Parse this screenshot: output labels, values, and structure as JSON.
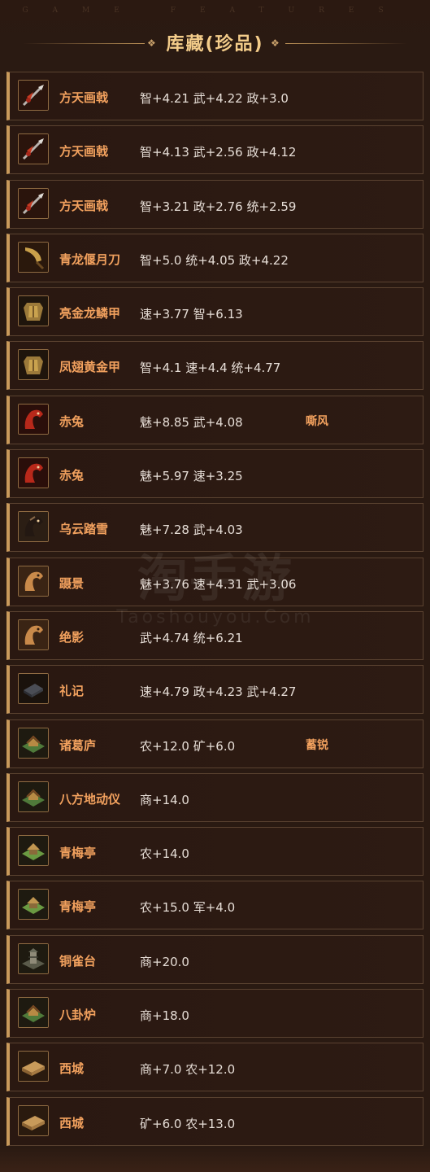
{
  "header": {
    "subtitle": "GAME FEATURES",
    "title": "库藏(珍品)"
  },
  "items": [
    {
      "name": "方天画戟",
      "stats": "智+4.21 武+4.22 政+3.0",
      "skill": "",
      "icon": "halberd-icon"
    },
    {
      "name": "方天画戟",
      "stats": "智+4.13 武+2.56 政+4.12",
      "skill": "",
      "icon": "halberd-icon"
    },
    {
      "name": "方天画戟",
      "stats": "智+3.21 政+2.76 统+2.59",
      "skill": "",
      "icon": "halberd-icon"
    },
    {
      "name": "青龙偃月刀",
      "stats": "智+5.0 统+4.05 政+4.22",
      "skill": "",
      "icon": "glaive-icon"
    },
    {
      "name": "亮金龙鳞甲",
      "stats": "速+3.77 智+6.13",
      "skill": "",
      "icon": "armor-icon"
    },
    {
      "name": "凤翅黄金甲",
      "stats": "智+4.1 速+4.4 统+4.77",
      "skill": "",
      "icon": "armor-icon"
    },
    {
      "name": "赤兔",
      "stats": "魅+8.85 武+4.08",
      "skill": "嘶风",
      "icon": "red-horse-icon"
    },
    {
      "name": "赤兔",
      "stats": "魅+5.97 速+3.25",
      "skill": "",
      "icon": "red-horse-icon"
    },
    {
      "name": "乌云踏雪",
      "stats": "魅+7.28 武+4.03",
      "skill": "",
      "icon": "black-horse-icon"
    },
    {
      "name": "蹑景",
      "stats": "魅+3.76 速+4.31 武+3.06",
      "skill": "",
      "icon": "horse-icon"
    },
    {
      "name": "绝影",
      "stats": "武+4.74 统+6.21",
      "skill": "",
      "icon": "horse-icon"
    },
    {
      "name": "礼记",
      "stats": "速+4.79 政+4.23 武+4.27",
      "skill": "",
      "icon": "book-icon"
    },
    {
      "name": "诸葛庐",
      "stats": "农+12.0 矿+6.0",
      "skill": "蓄锐",
      "icon": "building-icon"
    },
    {
      "name": "八方地动仪",
      "stats": "商+14.0",
      "skill": "",
      "icon": "building-icon"
    },
    {
      "name": "青梅亭",
      "stats": "农+14.0",
      "skill": "",
      "icon": "pavilion-icon"
    },
    {
      "name": "青梅亭",
      "stats": "农+15.0 军+4.0",
      "skill": "",
      "icon": "pavilion-icon"
    },
    {
      "name": "铜雀台",
      "stats": "商+20.0",
      "skill": "",
      "icon": "tower-icon"
    },
    {
      "name": "八卦炉",
      "stats": "商+18.0",
      "skill": "",
      "icon": "building-icon"
    },
    {
      "name": "西城",
      "stats": "商+7.0 农+12.0",
      "skill": "",
      "icon": "city-wall-icon"
    },
    {
      "name": "西城",
      "stats": "矿+6.0 农+13.0",
      "skill": "",
      "icon": "city-wall-icon"
    }
  ],
  "watermark": {
    "main": "淘手游",
    "sub": "Taoshouyou.Com"
  },
  "colors": {
    "accent": "#f2a15e",
    "title": "#f3cc8a",
    "border": "#c99a5b",
    "background": "#2a1a12"
  }
}
